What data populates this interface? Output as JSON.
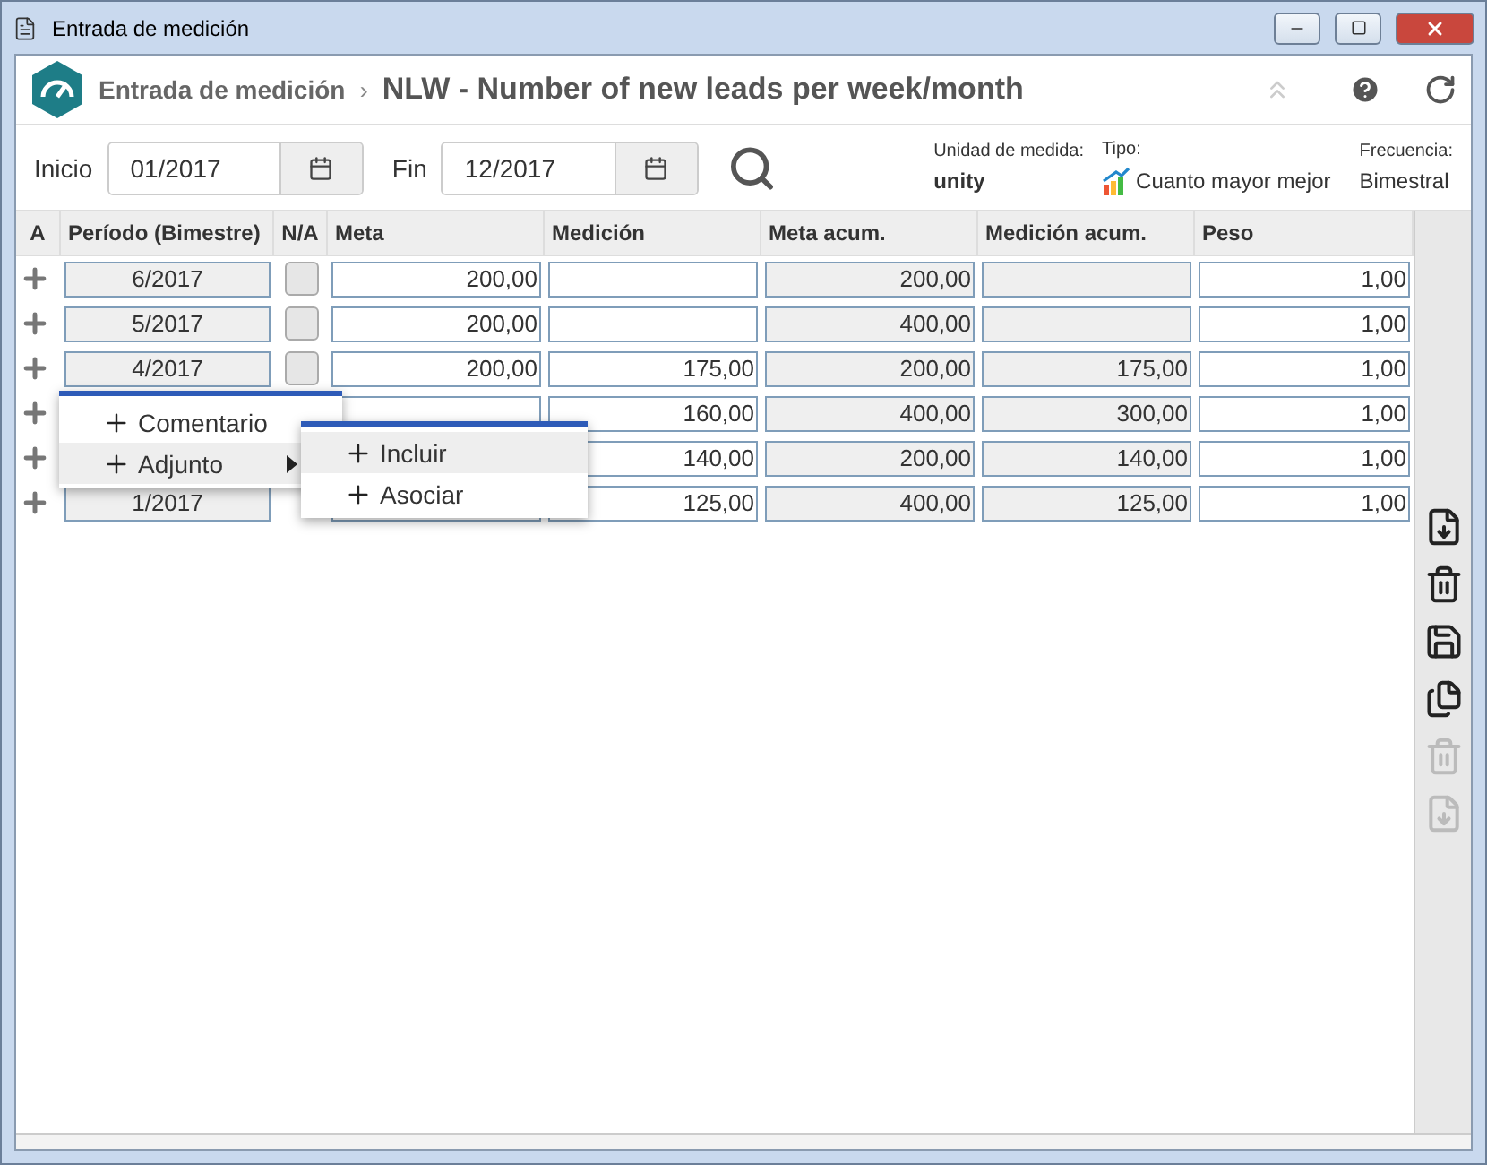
{
  "window": {
    "title": "Entrada de medición"
  },
  "header": {
    "breadcrumb": "Entrada de medición",
    "separator": "›",
    "title": "NLW - Number of new leads per week/month"
  },
  "filters": {
    "start": {
      "label": "Inicio",
      "value": "01/2017"
    },
    "end": {
      "label": "Fin",
      "value": "12/2017"
    }
  },
  "info": [
    {
      "label": "Unidad de medida:",
      "value": "unity",
      "kind": "plain"
    },
    {
      "label": "Tipo:",
      "value": "Cuanto mayor mejor",
      "kind": "trend"
    },
    {
      "label": "Frecuencia:",
      "value": "Bimestral",
      "kind": "plain"
    }
  ],
  "table": {
    "columns": [
      "A",
      "Período (Bimestre)",
      "N/A",
      "Meta",
      "Medición",
      "Meta acum.",
      "Medición acum.",
      "Peso"
    ],
    "rows": [
      {
        "na": false,
        "period": "6/2017",
        "meta": "200,00",
        "medicion": "",
        "meta_acum": "200,00",
        "medicion_acum": "",
        "peso": "1,00"
      },
      {
        "na": false,
        "period": "5/2017",
        "meta": "200,00",
        "medicion": "",
        "meta_acum": "400,00",
        "medicion_acum": "",
        "peso": "1,00"
      },
      {
        "na": false,
        "period": "4/2017",
        "meta": "200,00",
        "medicion": "175,00",
        "meta_acum": "200,00",
        "medicion_acum": "175,00",
        "peso": "1,00"
      },
      {
        "period": "",
        "meta": "",
        "medicion": "160,00",
        "meta_acum": "400,00",
        "medicion_acum": "300,00",
        "peso": "1,00"
      },
      {
        "period": "",
        "meta": "",
        "medicion": "140,00",
        "meta_acum": "200,00",
        "medicion_acum": "140,00",
        "peso": "1,00"
      },
      {
        "period": "1/2017",
        "meta": "",
        "medicion": "125,00",
        "meta_acum": "400,00",
        "medicion_acum": "125,00",
        "peso": "1,00"
      }
    ]
  },
  "context_menu": {
    "items": [
      {
        "label": "Comentario",
        "highlighted": false,
        "kind": "action"
      },
      {
        "label": "Adjunto",
        "highlighted": true,
        "kind": "submenu"
      }
    ]
  },
  "submenu": {
    "items": [
      {
        "label": "Incluir",
        "highlighted": true,
        "kind": "action"
      },
      {
        "label": "Asociar",
        "highlighted": false,
        "kind": "action"
      }
    ]
  },
  "toolbar": [
    {
      "kind": "new",
      "disabled": false
    },
    {
      "kind": "delete",
      "disabled": false
    },
    {
      "kind": "save",
      "disabled": false
    },
    {
      "kind": "copy",
      "disabled": false
    },
    {
      "kind": "delete",
      "disabled": true
    },
    {
      "kind": "new",
      "disabled": true
    }
  ]
}
